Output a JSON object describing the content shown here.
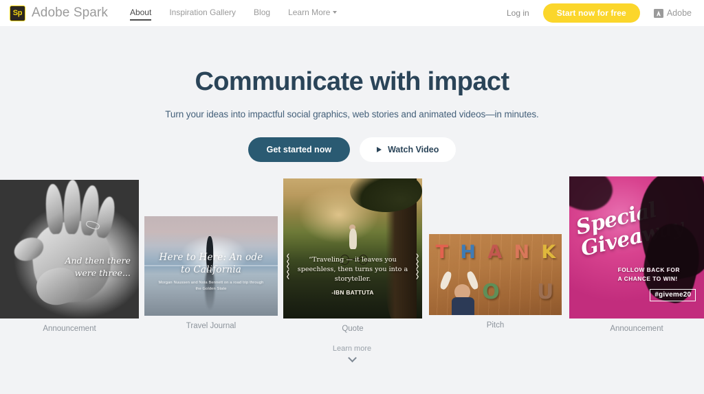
{
  "header": {
    "brand": {
      "mark": "Sp",
      "name": "Adobe Spark",
      "mark_icon": "spark-logo-icon"
    },
    "nav": [
      {
        "label": "About",
        "active": true
      },
      {
        "label": "Inspiration Gallery",
        "active": false
      },
      {
        "label": "Blog",
        "active": false
      },
      {
        "label": "Learn More",
        "active": false,
        "caret": "chevron-down-icon"
      }
    ],
    "login_label": "Log in",
    "cta_label": "Start now for free",
    "adobe_label": "Adobe",
    "adobe_icon": "adobe-a-icon",
    "colors": {
      "cta_yellow": "#fbd62b",
      "logo_yellow": "#f2d411",
      "logo_dark": "#2b2622",
      "nav_muted": "#9a9a9a"
    }
  },
  "hero": {
    "title": "Communicate with impact",
    "subtitle": "Turn your ideas into impactful social graphics, web stories and animated videos—in minutes.",
    "primary_button": "Get started now",
    "secondary_button": "Watch Video",
    "secondary_icon": "play-triangle-icon",
    "colors": {
      "title": "#2a4458",
      "primary_button": "#2a5a72",
      "page_background": "#f2f3f5"
    }
  },
  "cards": [
    {
      "label": "Announcement",
      "kind": "hands-photo",
      "overlay_text": "And then there\nwere three..."
    },
    {
      "label": "Travel Journal",
      "kind": "beach-photo",
      "overlay_title": "Here to Here: An ode to California",
      "overlay_subtitle": "Morgan Nuussen and Nola Bennett on a road trip through the Golden State"
    },
    {
      "label": "Quote",
      "kind": "cyclist-photo",
      "quote": "“Traveling — it leaves you speechless, then turns you into a storyteller.",
      "author": "-IBN BATTUTA",
      "ornament": "laurel-wreath-icon"
    },
    {
      "label": "Pitch",
      "kind": "thank-you-photo",
      "word_top": "THANK",
      "word_bottom": "YOU",
      "letter_colors": [
        "#e2624f",
        "#3f7bb5",
        "#c2574f",
        "#d9775a",
        "#e0903f",
        "#dfb73c"
      ],
      "you_colors": [
        "#5f8f58",
        "#9c6f52",
        "#8e6b8c"
      ]
    },
    {
      "label": "Announcement",
      "kind": "giveaway-graphic",
      "script_line1": "Special",
      "script_line2": "Giveaway",
      "sub_line1": "FOLLOW BACK FOR",
      "sub_line2": "A CHANCE TO WIN!",
      "hashtag": "#giveme20"
    }
  ],
  "footer": {
    "learn_more": "Learn more",
    "chevron_icon": "chevron-down-icon"
  }
}
